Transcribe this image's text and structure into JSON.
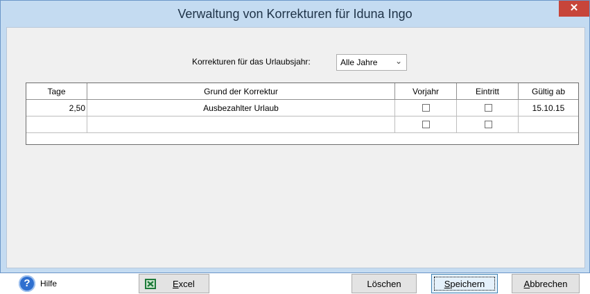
{
  "window": {
    "title": "Verwaltung von Korrekturen für Iduna Ingo",
    "close_glyph": "✕"
  },
  "filter": {
    "label": "Korrekturen für das Urlaubsjahr:",
    "selected": "Alle Jahre",
    "chevron": "⌄"
  },
  "table": {
    "headers": [
      "Tage",
      "Grund der Korrektur",
      "Vorjahr",
      "Eintritt",
      "Gültig ab"
    ],
    "rows": [
      {
        "tage": "2,50",
        "grund": "Ausbezahlter Urlaub",
        "vorjahr": false,
        "eintritt": false,
        "gueltig": "15.10.15"
      },
      {
        "tage": "",
        "grund": "",
        "vorjahr": false,
        "eintritt": false,
        "gueltig": ""
      }
    ]
  },
  "footer": {
    "help_label": "Hilfe",
    "help_glyph": "?",
    "excel_label_first": "E",
    "excel_label_rest": "xcel",
    "delete_label": "Löschen",
    "save_label_first": "S",
    "save_label_rest": "peichern",
    "cancel_label_first": "A",
    "cancel_label_rest": "bbrechen"
  }
}
